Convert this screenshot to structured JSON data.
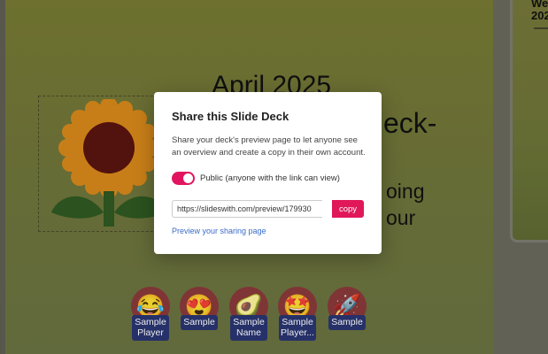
{
  "slide": {
    "title": "April 2025",
    "subtitle": "eck-",
    "line1": "oing",
    "line2": "our"
  },
  "thumbnail": {
    "title": "We\n202"
  },
  "avatars": [
    {
      "emoji": "😂",
      "label": "Sample Player"
    },
    {
      "emoji": "😍",
      "label": "Sample"
    },
    {
      "emoji": "🥑",
      "label": "Sample Name"
    },
    {
      "emoji": "🤩",
      "label": "Sample Player..."
    },
    {
      "emoji": "🚀",
      "label": "Sample"
    }
  ],
  "modal": {
    "title": "Share this Slide Deck",
    "description": "Share your deck's preview page to let anyone see an overview and create a copy in their own account.",
    "toggle_label": "Public (anyone with the link can view)",
    "url": "https://slideswith.com/preview/179930",
    "copy_label": "copy",
    "preview_link": "Preview your sharing page"
  },
  "colors": {
    "accent": "#e0185a",
    "link": "#3b6cc8",
    "tag": "#2a3672"
  },
  "icons": {
    "toggle": "toggle-on-icon",
    "sunflower": "sunflower-icon"
  }
}
